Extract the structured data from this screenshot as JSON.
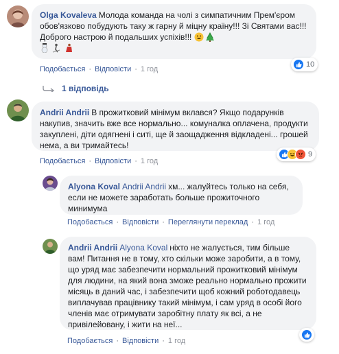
{
  "comments": [
    {
      "author": "Olga Kovaleva",
      "text": "Молода команда на чолі з симпатичним Прем'єром обов'язково побудують таку ж гарну й міцну країну!!! Зі Святами вас!!! Доброго настрою й подальших успіхів!!!",
      "like": "Подобається",
      "reply": "Відповісти",
      "time": "1 год",
      "reactions_count": "10"
    },
    {
      "author": "Andrii Andrii",
      "text": "В прожитковий мінімум вклався? Якщо подарунків накупив, значить вже все нормально... комуналка оплачена, продукти закуплені, діти одягнені і ситі, ще й заощадження відкладені... грошей нема, а ви тримайтесь!",
      "like": "Подобається",
      "reply": "Відповісти",
      "time": "1 год",
      "reactions_count": "9"
    },
    {
      "author": "Alyona Koval",
      "mention": "Andrii Andrii",
      "text": "хм... жалуйтесь только на себя, если не можете заработать больше прожиточного минимума",
      "like": "Подобається",
      "reply": "Відповісти",
      "translate": "Переглянути переклад",
      "time": "1 год"
    },
    {
      "author": "Andrii Andrii",
      "mention": "Alyona Koval",
      "text": "ніхто не жалується, тим більше вам! Питання не в тому, хто скільки може заробити, а в тому, що уряд має забезпечити нормальний прожитковий мінімум для людини, на який вона зможе реально нормально прожити місяць в даний час, і забезпечити щоб кожний роботодавець виплачував працівнику такий мінімум, і сам уряд в особі його членів має отримувати заробітну плату як всі, а не привілейовану, і жити на неї...",
      "like": "Подобається",
      "reply": "Відповісти",
      "time": "1 год"
    }
  ],
  "replies_link": "1 відповідь",
  "colors": {
    "link": "#385898",
    "bubble": "#f2f3f5",
    "meta": "#606770",
    "like_blue": "#1877f2",
    "angry": "#f0563a",
    "haha": "#f7c236"
  }
}
